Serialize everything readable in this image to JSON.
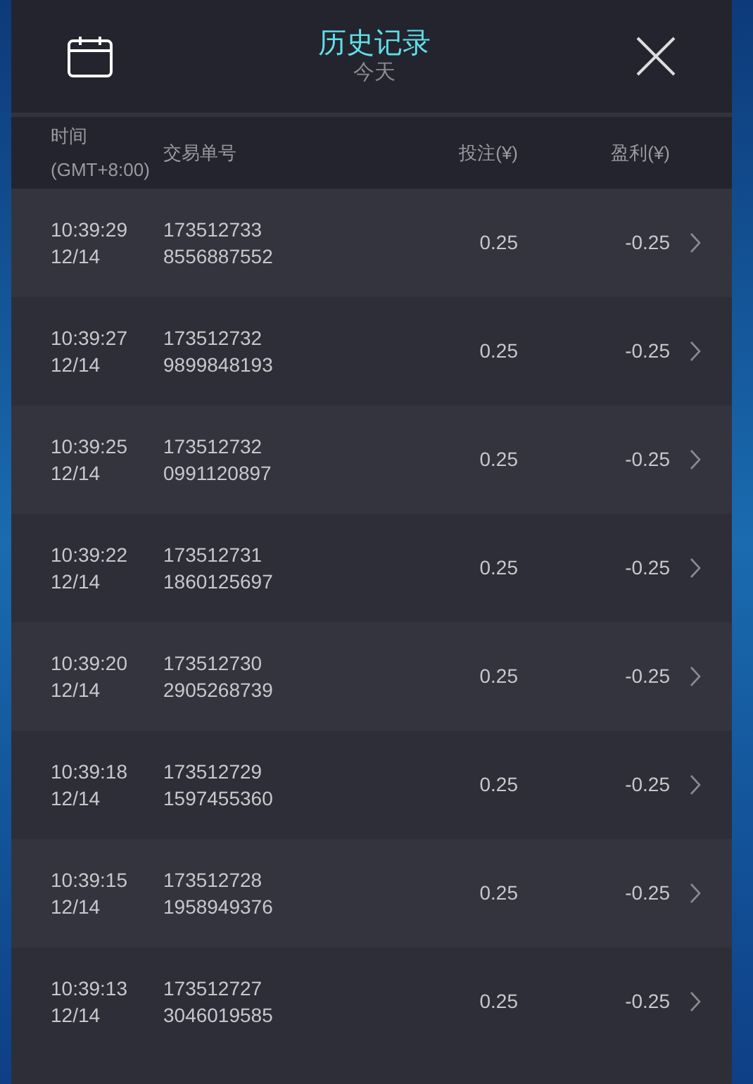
{
  "header": {
    "title": "历史记录",
    "subtitle": "今天"
  },
  "columns": [
    {
      "lines": [
        "时间",
        "(GMT+8:00)"
      ]
    },
    {
      "lines": [
        "交易单号"
      ]
    },
    {
      "lines": [
        "投注(¥)"
      ]
    },
    {
      "lines": [
        "盈利(¥)"
      ]
    }
  ],
  "rows": [
    {
      "time": "10:39:29",
      "date": "12/14",
      "order_no": [
        "173512733",
        "8556887552"
      ],
      "stake": "0.25",
      "profit": "-0.25"
    },
    {
      "time": "10:39:27",
      "date": "12/14",
      "order_no": [
        "173512732",
        "9899848193"
      ],
      "stake": "0.25",
      "profit": "-0.25"
    },
    {
      "time": "10:39:25",
      "date": "12/14",
      "order_no": [
        "173512732",
        "0991120897"
      ],
      "stake": "0.25",
      "profit": "-0.25"
    },
    {
      "time": "10:39:22",
      "date": "12/14",
      "order_no": [
        "173512731",
        "1860125697"
      ],
      "stake": "0.25",
      "profit": "-0.25"
    },
    {
      "time": "10:39:20",
      "date": "12/14",
      "order_no": [
        "173512730",
        "2905268739"
      ],
      "stake": "0.25",
      "profit": "-0.25"
    },
    {
      "time": "10:39:18",
      "date": "12/14",
      "order_no": [
        "173512729",
        "1597455360"
      ],
      "stake": "0.25",
      "profit": "-0.25"
    },
    {
      "time": "10:39:15",
      "date": "12/14",
      "order_no": [
        "173512728",
        "1958949376"
      ],
      "stake": "0.25",
      "profit": "-0.25"
    },
    {
      "time": "10:39:13",
      "date": "12/14",
      "order_no": [
        "173512727",
        "3046019585"
      ],
      "stake": "0.25",
      "profit": "-0.25"
    }
  ]
}
